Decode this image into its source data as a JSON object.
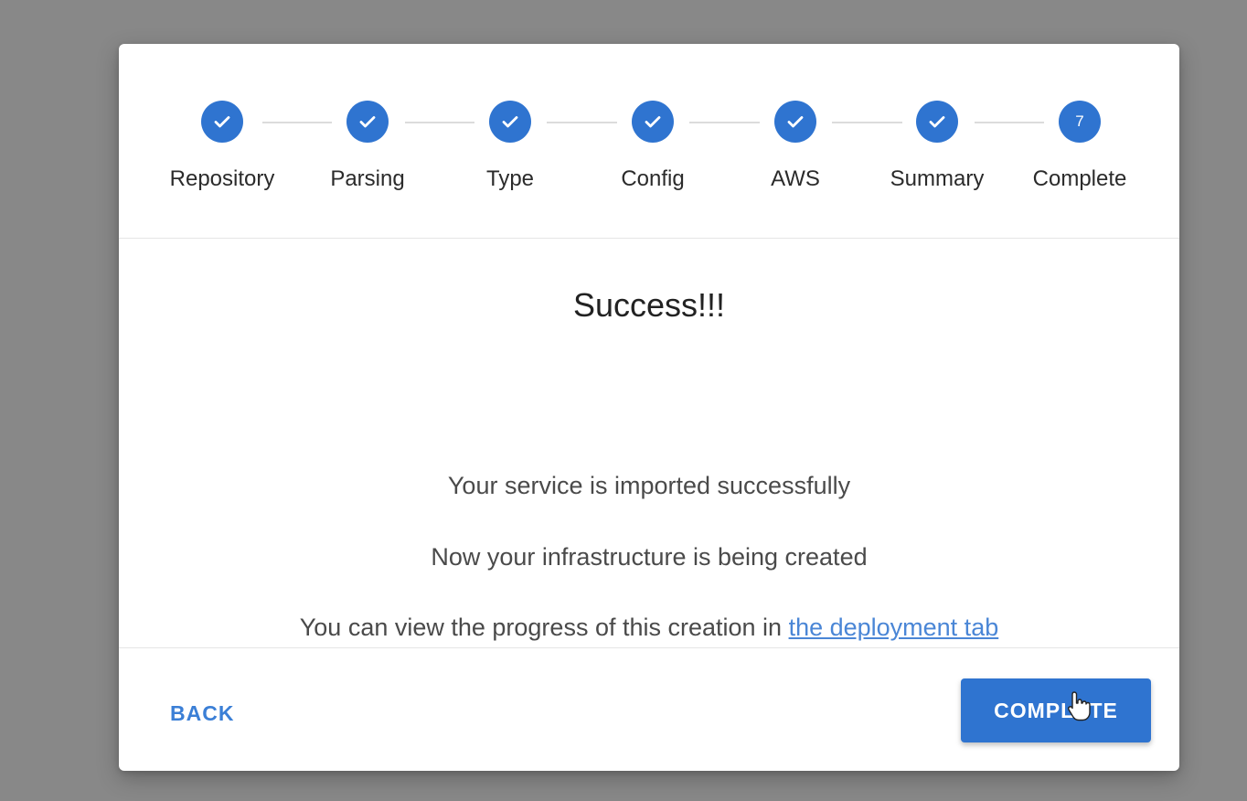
{
  "stepper": {
    "steps": [
      {
        "label": "Repository",
        "state": "done"
      },
      {
        "label": "Parsing",
        "state": "done"
      },
      {
        "label": "Type",
        "state": "done"
      },
      {
        "label": "Config",
        "state": "done"
      },
      {
        "label": "AWS",
        "state": "done"
      },
      {
        "label": "Summary",
        "state": "done"
      },
      {
        "label": "Complete",
        "state": "active",
        "number": "7"
      }
    ]
  },
  "content": {
    "title": "Success!!!",
    "line1": "Your service is imported successfully",
    "line2": "Now your infrastructure is being created",
    "line3_prefix": "You can view the progress of this creation in ",
    "line3_link": "the deployment tab"
  },
  "footer": {
    "back_label": "BACK",
    "complete_label": "COMPLETE"
  },
  "colors": {
    "accent": "#2f74d0",
    "link": "#4a86d6",
    "backdrop": "#888888"
  },
  "icons": {
    "done_step": "check-icon",
    "pointer": "hand-pointer-icon"
  }
}
